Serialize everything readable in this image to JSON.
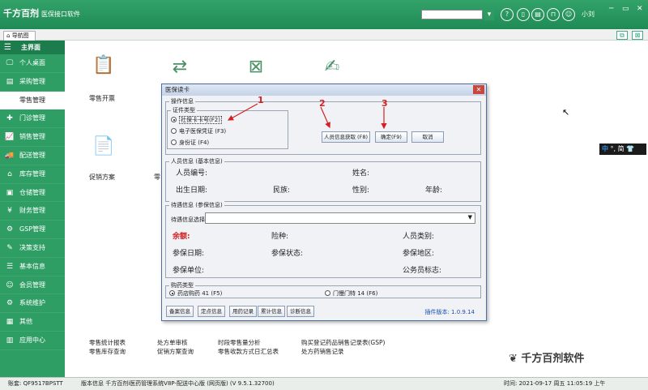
{
  "app": {
    "logo": "千方百剂",
    "subtitle": "医保接口软件",
    "username": "小刘",
    "search_icon": "search-icon"
  },
  "titlebar": {
    "minimize": "─",
    "restore": "▭",
    "close": "✕"
  },
  "tab": {
    "label": "导航图"
  },
  "sidebar": {
    "header": "主界面",
    "items": [
      {
        "label": "个人桌面",
        "icon": "🖵"
      },
      {
        "label": "采购管理",
        "icon": "▤"
      },
      {
        "label": "零售管理",
        "icon": ""
      },
      {
        "label": "门诊管理",
        "icon": "✚"
      },
      {
        "label": "销售管理",
        "icon": "📈"
      },
      {
        "label": "配送管理",
        "icon": "🚚"
      },
      {
        "label": "库存管理",
        "icon": "⌂"
      },
      {
        "label": "仓储管理",
        "icon": "▣"
      },
      {
        "label": "财务管理",
        "icon": "¥"
      },
      {
        "label": "GSP管理",
        "icon": "⚙"
      },
      {
        "label": "决策支持",
        "icon": "✎"
      },
      {
        "label": "基本信息",
        "icon": "☰"
      },
      {
        "label": "会员管理",
        "icon": "☺"
      },
      {
        "label": "系统维护",
        "icon": "⚙"
      },
      {
        "label": "其他",
        "icon": "▦"
      },
      {
        "label": "应用中心",
        "icon": "▥"
      }
    ]
  },
  "main": {
    "tiles": [
      {
        "label": "零售开票"
      },
      {
        "label": "促销方案"
      },
      {
        "label": "零"
      }
    ],
    "links": [
      {
        "label": "零售统计报表"
      },
      {
        "label": "零售库存查询"
      },
      {
        "label": "处方单审核"
      },
      {
        "label": "促销方案查询"
      },
      {
        "label": "时段零售量分析"
      },
      {
        "label": "零售收款方式日汇总表"
      },
      {
        "label": "购买登记药品销售记录表(GSP)"
      },
      {
        "label": "处方药销售记录"
      }
    ]
  },
  "dialog": {
    "title": "医保读卡",
    "op_group": "操作信息",
    "id_type_group": "证件类型",
    "id_types": [
      "社保卡卡号(F2)",
      "电子医保凭证 (F3)",
      "身份证  (F4)"
    ],
    "buttons": {
      "read": "人员信息获取 (F8)",
      "confirm": "确定(F9)",
      "cancel": "取消"
    },
    "basic_group": "人员信息 (基本信息)",
    "basic_fields": {
      "person_no": "人员编号:",
      "name": "姓名:",
      "birth": "出生日期:",
      "ethnic": "民族:",
      "gender": "性别:",
      "age": "年龄:"
    },
    "benefit_group": "待遇信息 (参保信息)",
    "benefit_select_label": "待遇信息选择",
    "benefit_fields": {
      "balance": "余额:",
      "insurance_type": "险种:",
      "person_category": "人员类别:",
      "insured_date": "参保日期:",
      "insured_status": "参保状态:",
      "insured_region": "参保地区:",
      "insured_unit": "参保单位:",
      "civil_servant": "公务员标志:"
    },
    "purchase_group": "购药类型",
    "purchase_types": [
      "药店购药 41 (F5)",
      "门慢门特 14 (F6)"
    ],
    "bottom_buttons": [
      "备案信息",
      "定点信息",
      "用药记录",
      "累计信息",
      "诊断信息"
    ],
    "plugin_version": "插件版本: 1.0.9.14"
  },
  "annotations": {
    "n1": "1",
    "n2": "2",
    "n3": "3"
  },
  "ime": {
    "zh": "中",
    "rest": "°, 简 👕"
  },
  "watermark": "千方百剂软件",
  "status": {
    "account": "账套: QF9517BPSTT",
    "version": "版本信息  千方百剂i医药管理系统V8P-配送中心版 (网页版) (V 9.5.1.32700)",
    "time": "时间: 2021-09-17 周五 11:05:19 上午"
  }
}
